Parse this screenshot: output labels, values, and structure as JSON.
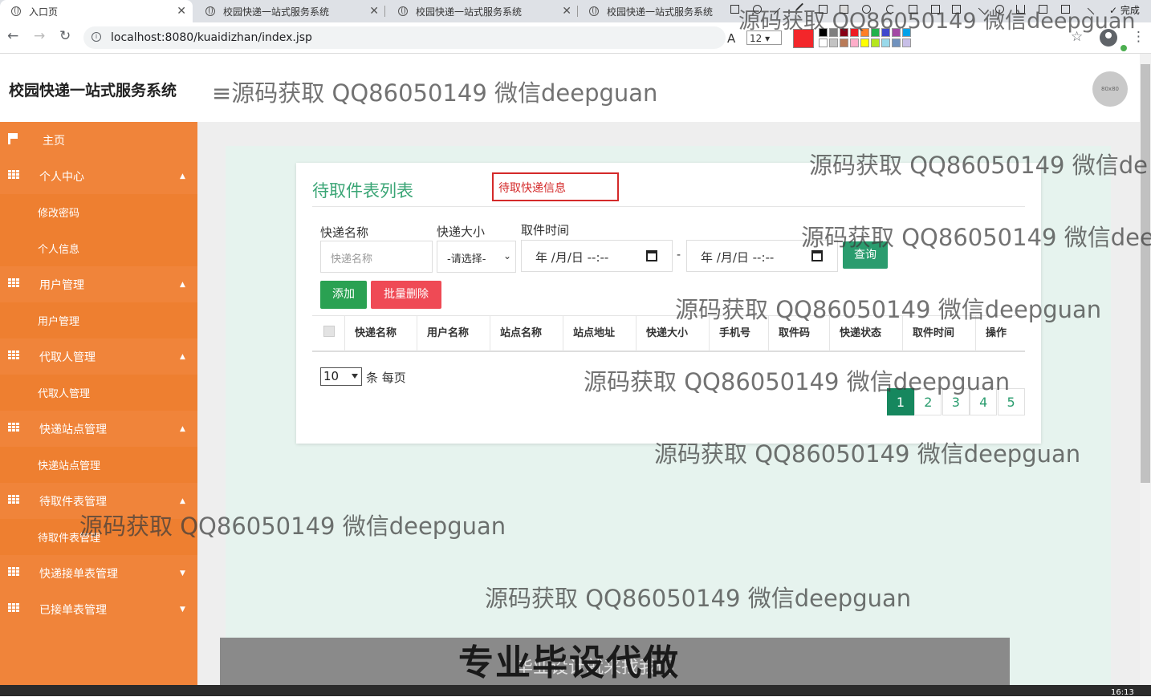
{
  "browser": {
    "tabs": [
      {
        "title": "入口页",
        "active": true
      },
      {
        "title": "校园快递一站式服务系统",
        "active": false
      },
      {
        "title": "校园快递一站式服务系统",
        "active": false
      },
      {
        "title": "校园快递一站式服务系统",
        "active": false
      }
    ],
    "url": "localhost:8080/kuaidizhan/index.jsp"
  },
  "annotation_toolbar": {
    "font_size": "12",
    "current_color": "#f3262a",
    "palette": [
      "#000000",
      "#7f7f7f",
      "#880015",
      "#ed1c24",
      "#ff7f27",
      "#22b14c",
      "#3f48cc",
      "#a349a4",
      "#00a2e8",
      "#ffffff",
      "#c3c3c3",
      "#b97a57",
      "#ffaec9",
      "#ffff00",
      "#b5e61d",
      "#99d9ea",
      "#7092be",
      "#c8bfe7"
    ],
    "finish_label": "完成"
  },
  "header": {
    "brand": "校园快递一站式服务系统",
    "menu_symbol": "≡",
    "avatar_text": "80x80"
  },
  "sidebar": {
    "items": [
      {
        "label": "主页",
        "type": "home"
      },
      {
        "label": "个人中心",
        "type": "group",
        "caret": "▲"
      },
      {
        "label": "修改密码",
        "type": "sub"
      },
      {
        "label": "个人信息",
        "type": "sub"
      },
      {
        "label": "用户管理",
        "type": "group",
        "caret": "▲"
      },
      {
        "label": "用户管理",
        "type": "sub"
      },
      {
        "label": "代取人管理",
        "type": "group",
        "caret": "▲"
      },
      {
        "label": "代取人管理",
        "type": "sub"
      },
      {
        "label": "快递站点管理",
        "type": "group",
        "caret": "▲"
      },
      {
        "label": "快递站点管理",
        "type": "sub"
      },
      {
        "label": "待取件表管理",
        "type": "group",
        "caret": "▲"
      },
      {
        "label": "待取件表管理",
        "type": "sub"
      },
      {
        "label": "快递接单表管理",
        "type": "group",
        "caret": "▼"
      },
      {
        "label": "已接单表管理",
        "type": "group",
        "caret": "▼"
      }
    ]
  },
  "page": {
    "title": "待取件表列表",
    "title_annotation": "待取快递信息",
    "filters": {
      "name_label": "快递名称",
      "name_placeholder": "快递名称",
      "size_label": "快递大小",
      "size_value": "-请选择-",
      "time_label": "取件时间",
      "date_start": "年 /月/日  --:--",
      "date_end": "年 /月/日  --:--",
      "range_sep": "-",
      "query_button": "查询"
    },
    "actions": {
      "add": "添加",
      "batch_delete": "批量删除"
    },
    "table": {
      "columns": [
        "快递名称",
        "用户名称",
        "站点名称",
        "站点地址",
        "快递大小",
        "手机号",
        "取件码",
        "快递状态",
        "取件时间",
        "操作"
      ],
      "rows": []
    },
    "pagination": {
      "page_size": "10",
      "per_page_label": "条 每页",
      "pages": [
        "1",
        "2",
        "3",
        "4",
        "5"
      ],
      "current": "1"
    }
  },
  "watermark": {
    "text": "源码获取 QQ86050149 微信deepguan",
    "text_partial_1": "源码获取 QQ86050149 微信de",
    "text_partial_2": "源码获取 QQ86050149 微信dee",
    "text_header": "≡源码获取 QQ86050149 微信deepguan"
  },
  "banner": {
    "big": "专业毕设代做",
    "sub": "毕业设计就来找我们"
  },
  "taskbar": {
    "clock": "16:13"
  }
}
